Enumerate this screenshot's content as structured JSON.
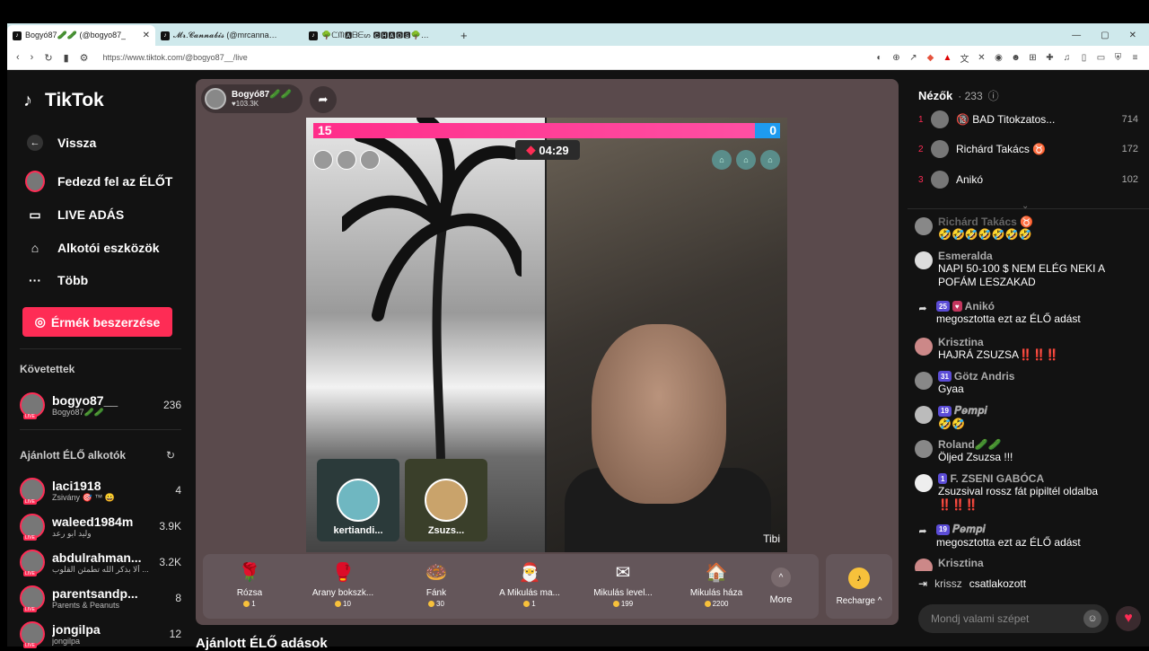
{
  "browser": {
    "tabs": [
      {
        "label": "Bogyó87🥒🥒 (@bogyo87_",
        "close": "✕"
      },
      {
        "label": "𝓜𝓻.𝓒𝓪𝓷𝓷𝓪𝓫𝓲𝓼 (@mrcannabis_)",
        "close": ""
      },
      {
        "label": "🌳ᙅᙏ🅰ᗷᗴᔕ 🅲🅷🅰🅾🆂🌳 (@csby01",
        "close": ""
      }
    ],
    "new_tab": "+",
    "url": "https://www.tiktok.com/@bogyo87__/live"
  },
  "sidebar": {
    "logo": "TikTok",
    "nav": [
      {
        "label": "Vissza",
        "icon": "back-arrow-icon"
      },
      {
        "label": "Fedezd fel az ÉLŐT",
        "icon": "explore-avatar-icon"
      },
      {
        "label": "LIVE ADÁS",
        "icon": "camera-icon"
      },
      {
        "label": "Alkotói eszközök",
        "icon": "creator-tools-icon"
      },
      {
        "label": "Több",
        "icon": "more-dots-icon"
      }
    ],
    "coins_button": "Érmék beszerzése",
    "following_title": "Követettek",
    "following": [
      {
        "name": "bogyo87__",
        "sub": "Bogyó87🥒🥒",
        "count": "236"
      }
    ],
    "recommended_title": "Ajánlott ÉLŐ alkotók",
    "recommended": [
      {
        "name": "laci1918",
        "sub": "Zsivány 🎯 ™ 😀",
        "count": "4"
      },
      {
        "name": "waleed1984m",
        "sub": "وليد ابو رعد",
        "count": "3.9K"
      },
      {
        "name": "abdulrahman...",
        "sub": "ألا بذكر الله تطمئن القلوب ...",
        "count": "3.2K"
      },
      {
        "name": "parentsandp...",
        "sub": "Parents & Peanuts",
        "count": "8"
      },
      {
        "name": "jongilpa",
        "sub": "jongilpa",
        "count": "12"
      }
    ],
    "live_badge": "LIVE"
  },
  "stage": {
    "streamer": {
      "name": "Bogyó87🥒🥒",
      "likes": "♥103.3K"
    },
    "score_left": "15",
    "score_right": "0",
    "timer": "04:29",
    "guests": [
      {
        "name": "kertiandi..."
      },
      {
        "name": "Zsuzs..."
      }
    ],
    "opponent_name": "Tibi",
    "gifts": [
      {
        "name": "Rózsa",
        "price": "1",
        "icon": "🌹"
      },
      {
        "name": "Arany bokszk...",
        "price": "10",
        "icon": "🥊"
      },
      {
        "name": "Fánk",
        "price": "30",
        "icon": "🍩"
      },
      {
        "name": "A Mikulás ma...",
        "price": "1",
        "icon": "🎅"
      },
      {
        "name": "Mikulás level...",
        "price": "199",
        "icon": "✉"
      },
      {
        "name": "Mikulás háza",
        "price": "2200",
        "icon": "🏠"
      }
    ],
    "more_label": "More",
    "recharge_label": "Recharge ^"
  },
  "below_title": "Ajánlott ÉLŐ adások",
  "viewers": {
    "title": "Nézők",
    "count": "· 233",
    "list": [
      {
        "rank": "1",
        "name": "🔞 BAD Titokzatos...",
        "score": "714"
      },
      {
        "rank": "2",
        "name": "Richárd Takács ♉",
        "score": "172"
      },
      {
        "rank": "3",
        "name": "Anikó",
        "score": "102"
      }
    ]
  },
  "chat": [
    {
      "user": "Richárd Takács ♉",
      "text": "🤣🤣🤣🤣🤣🤣🤣"
    },
    {
      "user": "Esmeralda",
      "text": "NAPI 50-100 $ NEM ELÉG NEKI A POFÁM LESZAKAD"
    },
    {
      "user": "Anikó",
      "badge": "25",
      "text": "megosztotta ezt az ÉLŐ adást"
    },
    {
      "user": "Krisztina",
      "text": "HAJRÁ ZSUZSA‼️‼️‼️"
    },
    {
      "user": "Götz Andris",
      "badge": "31",
      "text": "Gyaa"
    },
    {
      "user": "𝑷𝒆𝒎𝒑𝒊",
      "badge": "19",
      "text": "🤣🤣"
    },
    {
      "user": "Roland🥒🥒",
      "text": "Öljed Zsuzsa !!!"
    },
    {
      "user": "F. ZSENI GABÓCA",
      "badge": "1",
      "text": "Zsuzsival rossz fát pipiltél oldalba ‼️‼️‼️"
    },
    {
      "user": "𝑷𝒆𝒎𝒑𝒊",
      "badge": "19",
      "text": "megosztotta ezt az ÉLŐ adást"
    },
    {
      "user": "Krisztina",
      "text": ""
    }
  ],
  "join": {
    "user": "krissz",
    "text": "csatlakozott"
  },
  "input_placeholder": "Mondj valami szépet"
}
